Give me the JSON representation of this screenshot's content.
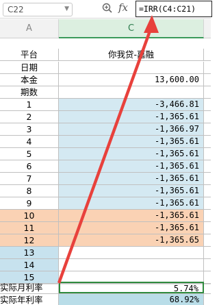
{
  "formula_bar": {
    "cell_ref": "C22",
    "zoom_icon": "zoom-icon",
    "fx_label": "fx",
    "formula": "=IRR(C4:C21)"
  },
  "columns": {
    "a": "A",
    "c": "C"
  },
  "header_row": {
    "a": "平台",
    "c": "你我贷-嘉融"
  },
  "info_rows": [
    {
      "a": "日期",
      "c": ""
    },
    {
      "a": "本金",
      "c": "13,600.00"
    },
    {
      "a": "期数",
      "c": ""
    }
  ],
  "payment_rows": [
    {
      "a": "1",
      "c": "-3,466.81"
    },
    {
      "a": "2",
      "c": "-1,365.61"
    },
    {
      "a": "3",
      "c": "-1,366.97"
    },
    {
      "a": "4",
      "c": "-1,365.61"
    },
    {
      "a": "5",
      "c": "-1,365.61"
    },
    {
      "a": "6",
      "c": "-1,365.61"
    },
    {
      "a": "7",
      "c": "-1,365.61"
    },
    {
      "a": "8",
      "c": "-1,365.61"
    },
    {
      "a": "9",
      "c": "-1,365.61"
    },
    {
      "a": "10",
      "c": "-1,365.61"
    },
    {
      "a": "11",
      "c": "-1,365.61"
    },
    {
      "a": "12",
      "c": "-1,365.65"
    },
    {
      "a": "13",
      "c": ""
    },
    {
      "a": "14",
      "c": ""
    },
    {
      "a": "15",
      "c": ""
    }
  ],
  "results": {
    "monthly_label": "实际月利率",
    "monthly_value": "5.74%",
    "annual_label": "实际年利率",
    "annual_value": "68.92%"
  },
  "colors": {
    "blue_fill": "#d4e9f2",
    "peach_fill": "#fad2b4",
    "selected_border": "#2e8b3e",
    "arrow": "#e8413c"
  }
}
